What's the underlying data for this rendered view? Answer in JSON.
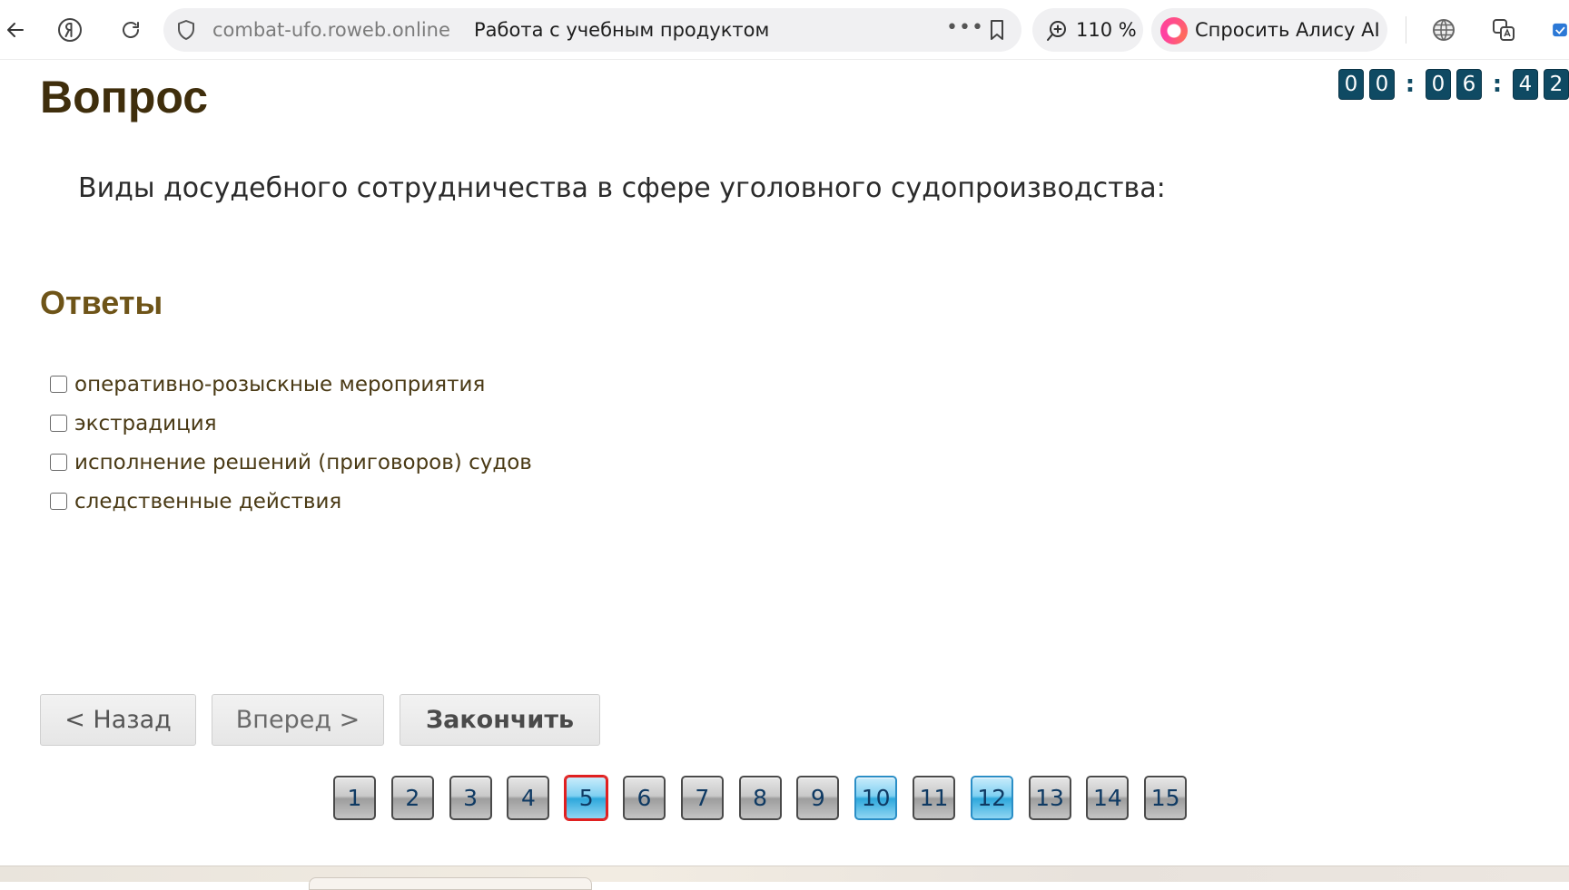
{
  "browser": {
    "domain": "combat-ufo.roweb.online",
    "page_title": "Работа с учебным продуктом",
    "zoom": "110 %",
    "alice_label": "Спросить Алису AI"
  },
  "timer": {
    "digits": [
      "0",
      "0",
      "0",
      "6",
      "4",
      "2"
    ],
    "separator": ":"
  },
  "question": {
    "heading": "Вопрос",
    "text": "Виды досудебного сотрудничества в сфере уголовного судопроизводства:"
  },
  "answers": {
    "heading": "Ответы",
    "options": [
      {
        "label": "оперативно-розыскные мероприятия",
        "checked": false
      },
      {
        "label": "экстрадиция",
        "checked": false
      },
      {
        "label": "исполнение решений (приговоров) судов",
        "checked": false
      },
      {
        "label": "следственные действия",
        "checked": false
      }
    ]
  },
  "nav": {
    "back_label": "< Назад",
    "forward_label": "Вперед >",
    "finish_label": "Закончить"
  },
  "pager": {
    "pages": [
      {
        "n": "1",
        "state": "default"
      },
      {
        "n": "2",
        "state": "default"
      },
      {
        "n": "3",
        "state": "default"
      },
      {
        "n": "4",
        "state": "default"
      },
      {
        "n": "5",
        "state": "current"
      },
      {
        "n": "6",
        "state": "default"
      },
      {
        "n": "7",
        "state": "default"
      },
      {
        "n": "8",
        "state": "default"
      },
      {
        "n": "9",
        "state": "default"
      },
      {
        "n": "10",
        "state": "answered"
      },
      {
        "n": "11",
        "state": "default"
      },
      {
        "n": "12",
        "state": "answered"
      },
      {
        "n": "13",
        "state": "default"
      },
      {
        "n": "14",
        "state": "default"
      },
      {
        "n": "15",
        "state": "default"
      }
    ]
  },
  "colors": {
    "heading": "#3f2e0c",
    "answers_heading": "#6e5418",
    "timer_bg": "#0f4a63",
    "current_border": "#e02020",
    "answered_fill": "#2ea8dc"
  }
}
